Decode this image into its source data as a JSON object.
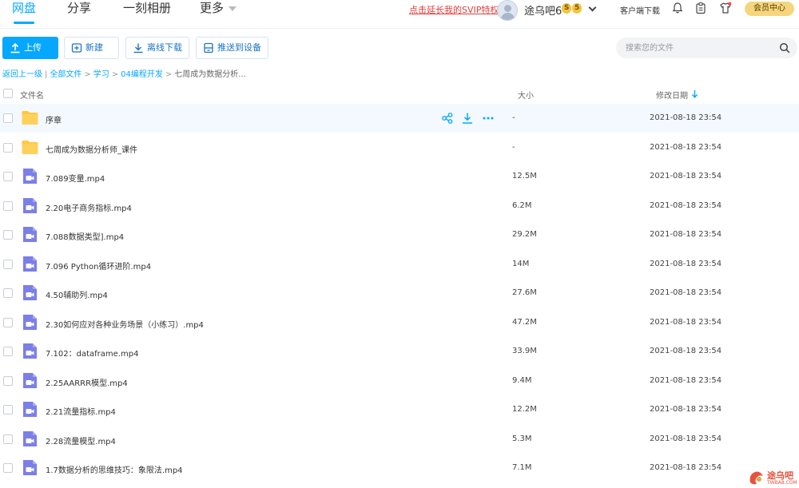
{
  "nav": {
    "tabs": [
      {
        "label": "网盘",
        "active": true
      },
      {
        "label": "分享",
        "active": false
      },
      {
        "label": "一刻相册",
        "active": false
      },
      {
        "label": "更多",
        "active": false
      }
    ],
    "svip_link": "点击延长我的SVIP特权",
    "username": "途乌吧6",
    "badges": [
      "S",
      "5"
    ],
    "client_download": "客户端下载",
    "member_center": "会员中心"
  },
  "toolbar": {
    "upload": "上传",
    "new": "新建",
    "offline_download": "离线下载",
    "push_device": "推送到设备",
    "search_placeholder": "搜索您的文件"
  },
  "breadcrumb": {
    "back": "返回上一级",
    "items": [
      "全部文件",
      "学习",
      "04编程开发"
    ],
    "current": "七周成为数据分析..."
  },
  "columns": {
    "name": "文件名",
    "size": "大小",
    "modified": "修改日期"
  },
  "files": [
    {
      "name": "序章",
      "type": "folder",
      "size": "-",
      "date": "2021-08-18 23:54"
    },
    {
      "name": "七周成为数据分析师_课件",
      "type": "folder",
      "size": "-",
      "date": "2021-08-18 23:54"
    },
    {
      "name": "7.089变量.mp4",
      "type": "video",
      "size": "12.5M",
      "date": "2021-08-18 23:54"
    },
    {
      "name": "2.20电子商务指标.mp4",
      "type": "video",
      "size": "6.2M",
      "date": "2021-08-18 23:54"
    },
    {
      "name": "7.088数据类型].mp4",
      "type": "video",
      "size": "29.2M",
      "date": "2021-08-18 23:54"
    },
    {
      "name": "7.096 Python循环进阶.mp4",
      "type": "video",
      "size": "14M",
      "date": "2021-08-18 23:54"
    },
    {
      "name": "4.50辅助列.mp4",
      "type": "video",
      "size": "27.6M",
      "date": "2021-08-18 23:54"
    },
    {
      "name": "2.30如何应对各种业务场景（小练习）.mp4",
      "type": "video",
      "size": "47.2M",
      "date": "2021-08-18 23:54"
    },
    {
      "name": "7.102：dataframe.mp4",
      "type": "video",
      "size": "33.9M",
      "date": "2021-08-18 23:54"
    },
    {
      "name": "2.25AARRR模型.mp4",
      "type": "video",
      "size": "9.4M",
      "date": "2021-08-18 23:54"
    },
    {
      "name": "2.21流量指标.mp4",
      "type": "video",
      "size": "12.2M",
      "date": "2021-08-18 23:54"
    },
    {
      "name": "2.28流量模型.mp4",
      "type": "video",
      "size": "5.3M",
      "date": "2021-08-18 23:54"
    },
    {
      "name": "1.7数据分析的思维技巧：象限法.mp4",
      "type": "video",
      "size": "7.1M",
      "date": "2021-08-18 23:54"
    }
  ],
  "watermark": {
    "text": "途乌吧",
    "sub": "TWBA8.COM"
  },
  "colors": {
    "accent": "#06a7ff",
    "folder": "#ffc83d",
    "video": "#7b7fe8",
    "svip": "#e23d3d"
  }
}
